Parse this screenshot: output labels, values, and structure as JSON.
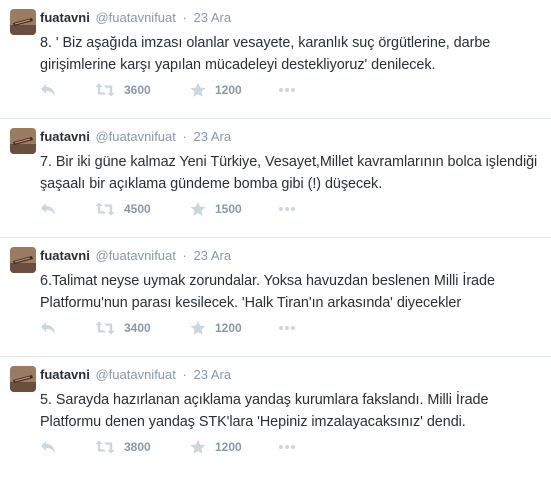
{
  "colors": {
    "name": "#292f33",
    "meta": "#8899a6",
    "icon": "#ccd6dd",
    "divider": "#e1e8ed"
  },
  "icons": [
    "reply-icon",
    "retweet-icon",
    "favorite-icon",
    "more-icon"
  ],
  "tweets": [
    {
      "name": "fuatavni",
      "handle": "@fuatavnifuat",
      "dot": "·",
      "time": "23 Ara",
      "text": "8. ' Biz aşağıda imzası olanlar vesayete, karanlık suç örgütlerine, darbe girişimlerine karşı yapılan mücadeleyi destekliyoruz' denilecek.",
      "retweets": "3600",
      "favorites": "1200"
    },
    {
      "name": "fuatavni",
      "handle": "@fuatavnifuat",
      "dot": "·",
      "time": "23 Ara",
      "text": "7. Bir iki güne kalmaz Yeni Türkiye, Vesayet,Millet kavramlarının bolca işlendiği şaşaalı bir açıklama gündeme bomba gibi (!) düşecek.",
      "retweets": "4500",
      "favorites": "1500"
    },
    {
      "name": "fuatavni",
      "handle": "@fuatavnifuat",
      "dot": "·",
      "time": "23 Ara",
      "text": "6.Talimat neyse uymak zorundalar. Yoksa havuzdan beslenen Milli İrade Platformu'nun parası kesilecek. 'Halk Tiran'ın arkasında' diyecekler",
      "retweets": "3400",
      "favorites": "1200"
    },
    {
      "name": "fuatavni",
      "handle": "@fuatavnifuat",
      "dot": "·",
      "time": "23 Ara",
      "text": "5. Sarayda hazırlanan açıklama yandaş kurumlara fakslandı. Milli İrade Platformu denen yandaş STK'lara 'Hepiniz imzalayacaksınız' dendi.",
      "retweets": "3800",
      "favorites": "1200"
    }
  ]
}
